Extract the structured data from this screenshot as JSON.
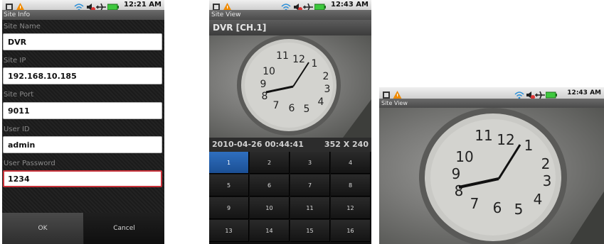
{
  "screen1": {
    "status_time": "12:21 AM",
    "title": "Site Info",
    "fields": [
      {
        "label": "Site Name",
        "value": "DVR"
      },
      {
        "label": "Site IP",
        "value": "192.168.10.185"
      },
      {
        "label": "Site Port",
        "value": "9011"
      },
      {
        "label": "User ID",
        "value": "admin"
      },
      {
        "label": "User Password",
        "value": "1234"
      }
    ],
    "ok_label": "OK",
    "cancel_label": "Cancel"
  },
  "screen2": {
    "status_time": "12:43 AM",
    "title": "Site View",
    "channel": "DVR [CH.1]",
    "timestamp": "2010-04-26 00:44:41",
    "resolution": "352 X 240",
    "keys": [
      "1",
      "2",
      "3",
      "4",
      "5",
      "6",
      "7",
      "8",
      "9",
      "10",
      "11",
      "12",
      "13",
      "14",
      "15",
      "16"
    ],
    "active_key": "1"
  },
  "screen3": {
    "status_time": "12:43 AM",
    "title": "Site View"
  },
  "icons": {
    "status": [
      "usb-icon",
      "warning-icon",
      "wifi-icon",
      "mute-icon",
      "airplane-icon",
      "battery-icon"
    ]
  },
  "colors": {
    "active_key": "#2f6fbf",
    "focus_border": "#c8323a",
    "battery": "#3ec83e",
    "warning": "#f08a00"
  }
}
